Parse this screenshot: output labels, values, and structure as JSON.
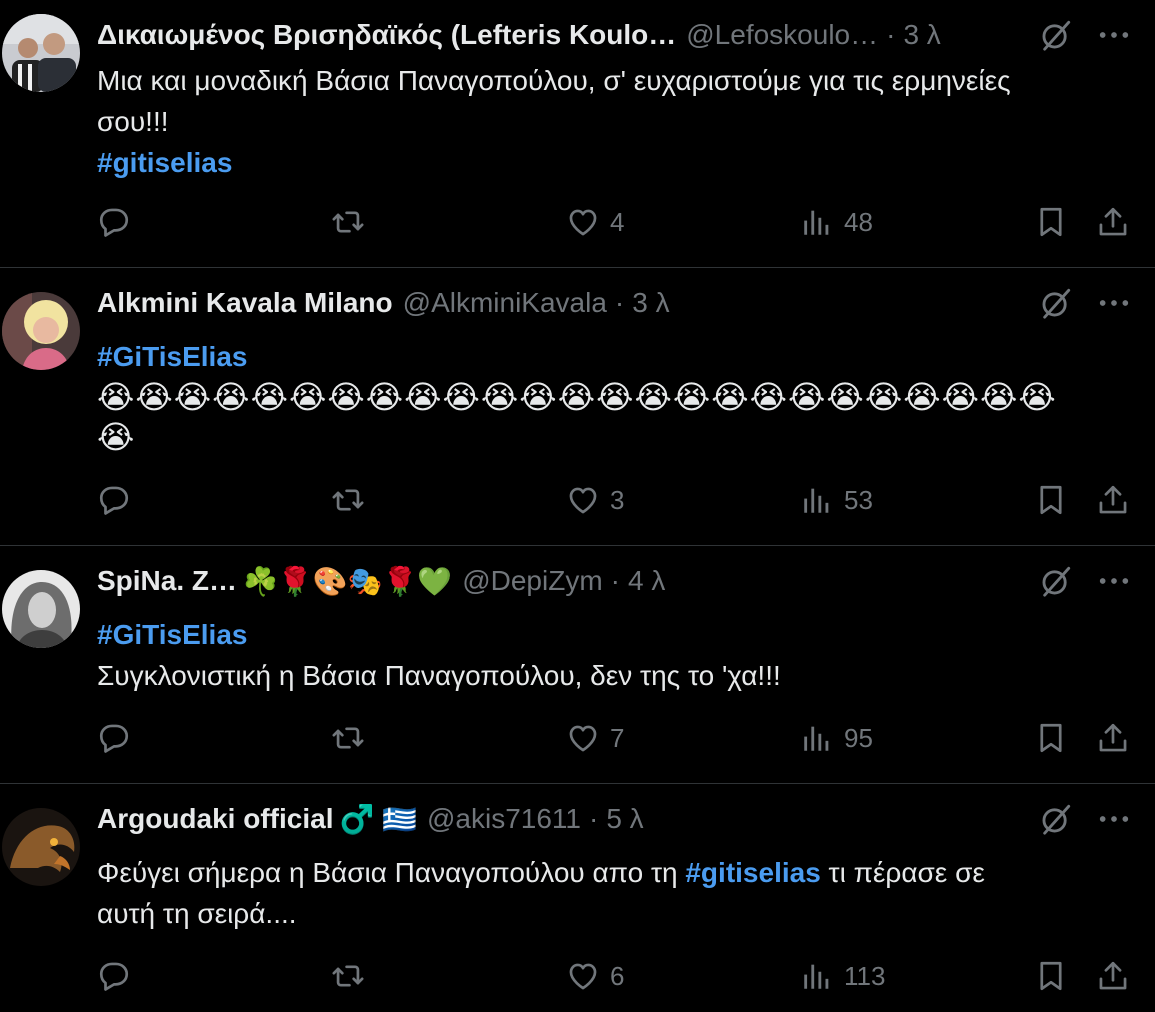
{
  "tweets": [
    {
      "name": "Δικαιωμένος Βρισηδαϊκός (Lefteris Koulo…",
      "emoji": "",
      "handle": "@Lefoskoulo…",
      "time": "3 λ",
      "lines": [
        "Μια και μοναδική Βάσια Παναγοπούλου, σ' ευχαριστούμε για τις ερμηνείες",
        "σου!!!"
      ],
      "hashtag": "#gitiselias",
      "reply_count": "",
      "retweet_count": "",
      "like_count": "4",
      "view_count": "48"
    },
    {
      "name": "Alkmini Kavala Milano",
      "emoji": "",
      "handle": "@AlkminiKavala",
      "time": "3 λ",
      "hashtag": "#GiTisElias",
      "emoji_line1": "😭😭😭😭😭😭😭😭😭😭😭😭😭😭😭😭😭😭😭😭😭😭😭😭😭",
      "emoji_line2": "😭",
      "reply_count": "",
      "retweet_count": "",
      "like_count": "3",
      "view_count": "53"
    },
    {
      "name": "SpiNa. Z…",
      "emoji": "☘️🌹🎨🎭🌹💚",
      "handle": "@DepiZym",
      "time": "4 λ",
      "hashtag": "#GiTisElias",
      "text": "Συγκλονιστική η Βάσια Παναγοπούλου, δεν της το 'χα!!!",
      "reply_count": "",
      "retweet_count": "",
      "like_count": "7",
      "view_count": "95"
    },
    {
      "name": "Argoudaki official",
      "emoji": "♂️ 🇬🇷",
      "handle": "@akis71611",
      "time": "5 λ",
      "text_before": "Φεύγει σήμερα η Βάσια Παναγοπούλου απο τη ",
      "hashtag": "#gitiselias",
      "text_after": " τι πέρασε σε",
      "line2": "αυτή τη σειρά....",
      "reply_count": "",
      "retweet_count": "",
      "like_count": "6",
      "view_count": "113"
    }
  ],
  "separator": "·",
  "colors": {
    "background": "#000000",
    "text": "#e7e9ea",
    "muted": "#71767b",
    "link": "#4b9cf0",
    "divider": "#2f3336"
  },
  "icons": [
    "reply-icon",
    "retweet-icon",
    "like-icon",
    "views-icon",
    "bookmark-icon",
    "share-icon",
    "grok-icon",
    "more-icon"
  ]
}
